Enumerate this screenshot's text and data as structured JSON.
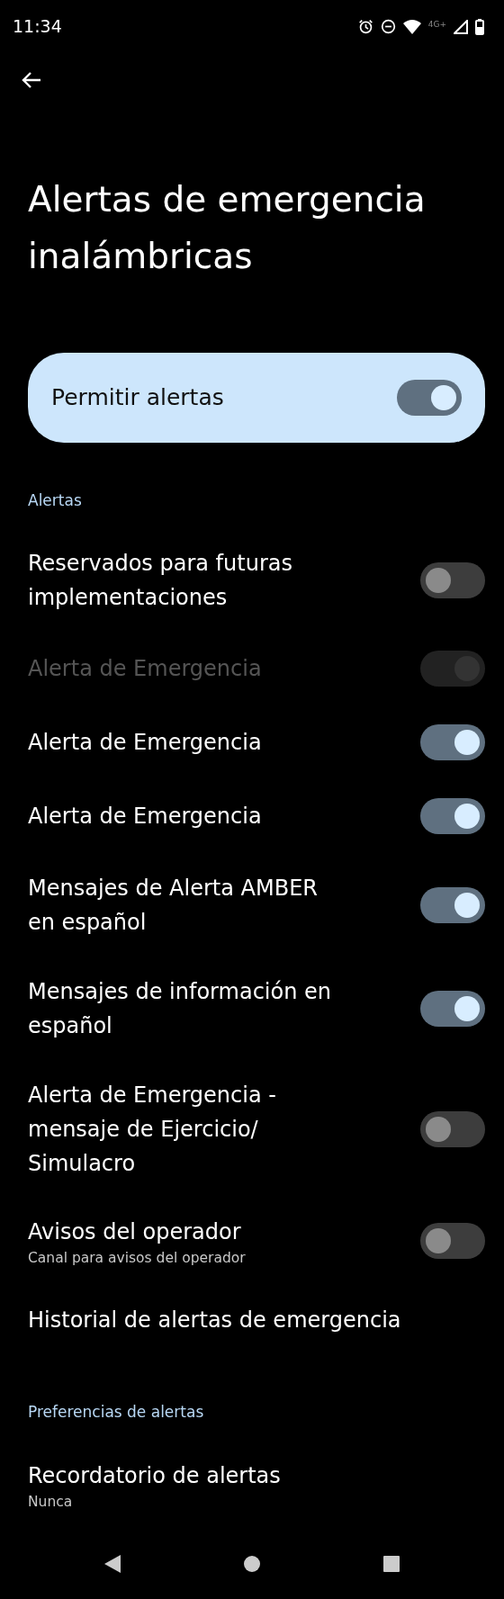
{
  "status_bar": {
    "time": "11:34",
    "network": "4G+"
  },
  "title": "Alertas de emergencia inalámbricas",
  "master": {
    "label": "Permitir alertas",
    "on": true
  },
  "sections": [
    {
      "header": "Alertas",
      "items": [
        {
          "kind": "toggle",
          "title": "Reservados para futuras implementaciones",
          "on": false,
          "disabled": false
        },
        {
          "kind": "toggle",
          "title": "Alerta de Emergencia",
          "on": true,
          "disabled": true
        },
        {
          "kind": "toggle",
          "title": "Alerta de Emergencia",
          "on": true,
          "disabled": false
        },
        {
          "kind": "toggle",
          "title": "Alerta de Emergencia",
          "on": true,
          "disabled": false
        },
        {
          "kind": "toggle",
          "title": "Mensajes de Alerta AMBER en español",
          "on": true,
          "disabled": false
        },
        {
          "kind": "toggle",
          "title": "Mensajes de información en español",
          "on": true,
          "disabled": false
        },
        {
          "kind": "toggle",
          "title": "Alerta de Emergencia - mensaje de Ejercicio/ Simulacro",
          "on": false,
          "disabled": false
        },
        {
          "kind": "toggle",
          "title": "Avisos del operador",
          "summary": "Canal para avisos del operador",
          "on": false,
          "disabled": false
        },
        {
          "kind": "link",
          "title": "Historial de alertas de emergencia"
        }
      ]
    },
    {
      "header": "Preferencias de alertas",
      "items": [
        {
          "kind": "link",
          "title": "Recordatorio de alertas",
          "summary": "Nunca"
        }
      ]
    }
  ]
}
